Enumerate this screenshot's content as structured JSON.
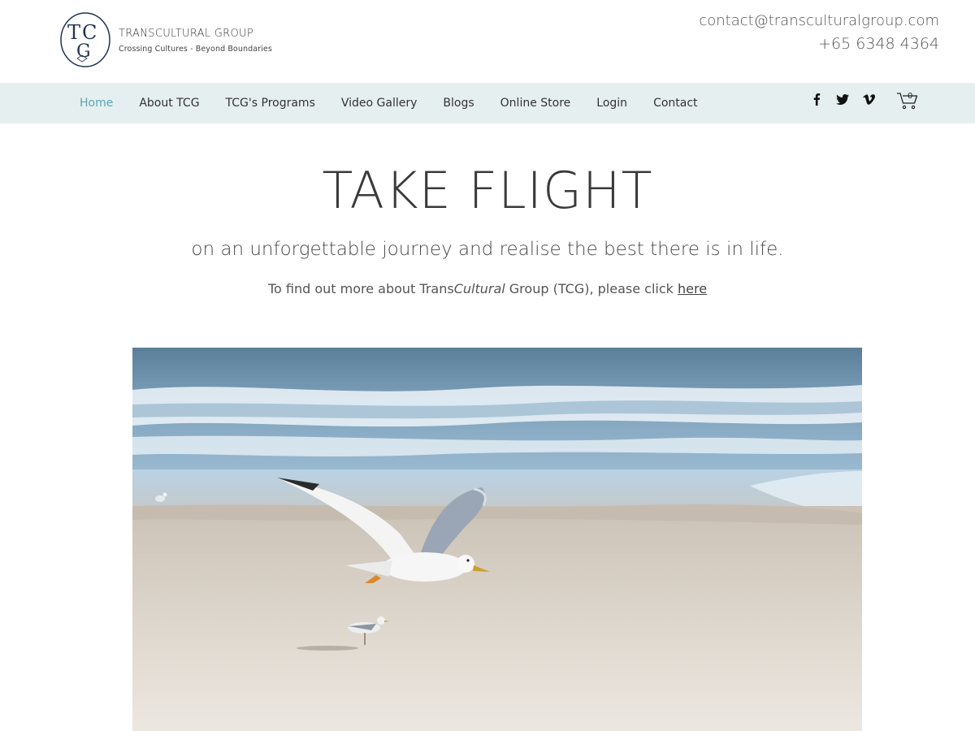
{
  "header": {
    "logo_letters": "TCG",
    "brand_name": "TRANSCULTURAL GROUP",
    "tagline": "Crossing Cultures - Beyond Boundaries",
    "email": "contact@transculturalgroup.com",
    "phone": "+65 6348 4364"
  },
  "nav": {
    "items": [
      {
        "label": "Home",
        "active": true
      },
      {
        "label": "About TCG"
      },
      {
        "label": "TCG's Programs"
      },
      {
        "label": "Video Gallery"
      },
      {
        "label": "Blogs"
      },
      {
        "label": "Online Store"
      },
      {
        "label": "Login"
      },
      {
        "label": "Contact"
      }
    ],
    "social": [
      "facebook-icon",
      "twitter-icon",
      "vimeo-icon"
    ],
    "cart_count": "0",
    "active_color": "#5aa6b5",
    "bar_color": "#e6eff0"
  },
  "hero": {
    "title": "TAKE FLIGHT",
    "subtitle": "on an unforgettable journey and realise the best there is in life.",
    "info_prefix": "To find out more about Trans",
    "info_italic": "Cultural",
    "info_suffix": " Group (TCG), please click ",
    "info_link": "here"
  }
}
